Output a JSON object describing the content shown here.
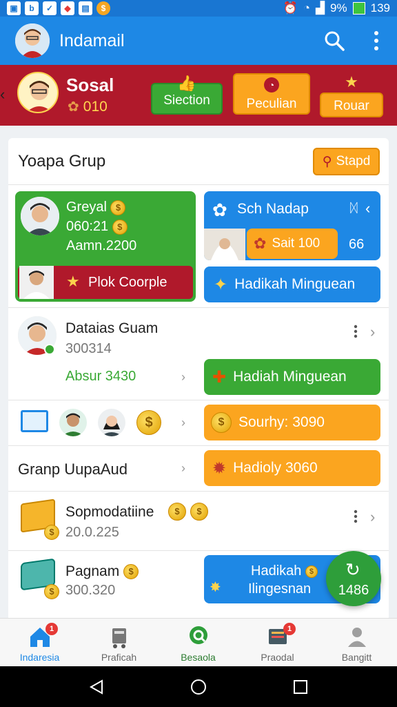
{
  "status_bar": {
    "battery": "9%",
    "signal_extra": "139"
  },
  "app_bar": {
    "title": "Indamail"
  },
  "banner": {
    "user_name": "Sosal",
    "points": "010",
    "buttons": [
      {
        "label": "Siection",
        "color": "#3aa935"
      },
      {
        "label": "Peculian",
        "color": "#fba51f"
      },
      {
        "label": "Rouar",
        "color": "#fba51f"
      }
    ]
  },
  "group": {
    "title": "Yoapa Grup",
    "action": "Stapd"
  },
  "green_card": {
    "name": "Greyal",
    "time": "060:21",
    "amount": "Aamn.2200",
    "strip_label": "Plok Coorple"
  },
  "blue_card": {
    "title": "Sch Nadap",
    "pill_label": "Sait 100",
    "count": "66"
  },
  "hadiah_button_1": "Hadikah Minguean",
  "rows": [
    {
      "title": "Dataias Guam",
      "sub": "300314",
      "extra": "Absur 3430",
      "button": "Hadiah Minguean"
    },
    {
      "button": "Sourhy: 3090"
    },
    {
      "title": "Granp UupaAud",
      "button": "Hadioly 3060"
    },
    {
      "title": "Sopmodatiine",
      "sub": "20.0.225"
    },
    {
      "title": "Pagnam",
      "sub": "300.320",
      "button_line1": "Hadikah",
      "button_line2": "Ilingesnan"
    }
  ],
  "fab": {
    "value": "1486"
  },
  "bottom_nav": [
    {
      "label": "Indaresia",
      "badge": "1"
    },
    {
      "label": "Praficah"
    },
    {
      "label": "Besaola"
    },
    {
      "label": "Praodal",
      "badge": "1"
    },
    {
      "label": "Bangitt"
    }
  ],
  "colors": {
    "primary": "#1e88e5",
    "red": "#b0192b",
    "green": "#3aa935",
    "orange": "#fba51f"
  }
}
